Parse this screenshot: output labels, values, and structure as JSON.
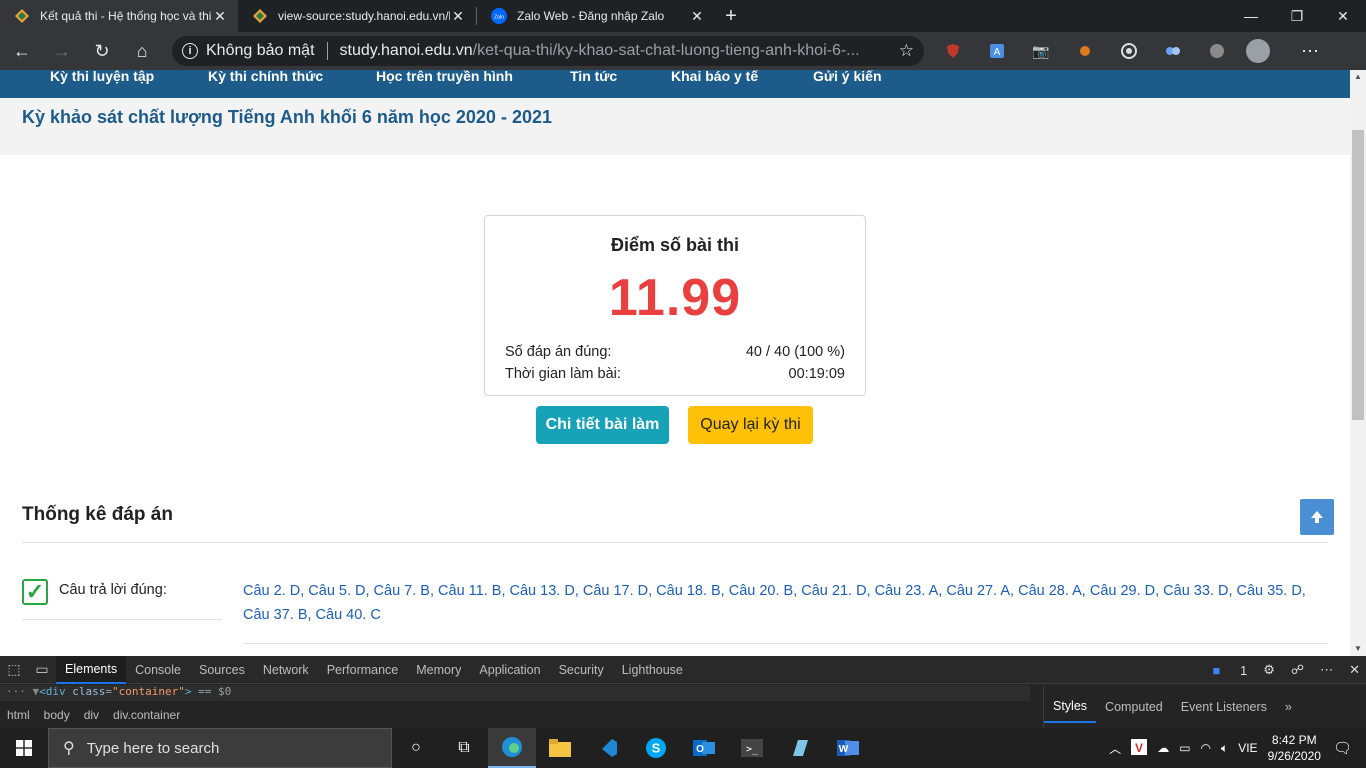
{
  "browser": {
    "tabs": [
      {
        "title": "Kết quả thi - Hệ thống học và thi",
        "active": true
      },
      {
        "title": "view-source:study.hanoi.edu.vn/k",
        "active": false
      },
      {
        "title": "Zalo Web - Đăng nhập Zalo",
        "active": false
      }
    ],
    "security_label": "Không bảo mật",
    "url_host": "study.hanoi.edu.vn",
    "url_path": "/ket-qua-thi/ky-khao-sat-chat-luong-tieng-anh-khoi-6-..."
  },
  "site_nav": {
    "items": [
      "Kỳ thi luyện tập",
      "Kỳ thi chính thức",
      "Học trên truyền hình",
      "Tin tức",
      "Khai báo y tế",
      "Gửi ý kiến"
    ]
  },
  "page_title": "Kỳ khảo sát chất lượng Tiếng Anh khối 6 năm học 2020 - 2021",
  "score_card": {
    "heading": "Điểm số bài thi",
    "score": "11.99",
    "correct_label": "Số đáp án đúng:",
    "correct_value": "40 / 40 (100 %)",
    "time_label": "Thời gian làm bài:",
    "time_value": "00:19:09"
  },
  "buttons": {
    "detail": "Chi tiết bài làm",
    "back": "Quay lại kỳ thi"
  },
  "stats": {
    "heading": "Thống kê đáp án",
    "correct_answers_label": "Câu trả lời đúng:",
    "correct_answers": "Câu 2. D, Câu 5. D, Câu 7. B, Câu 11. B, Câu 13. D, Câu 17. D, Câu 18. B, Câu 20. B, Câu 21. D, Câu 23. A, Câu 27. A, Câu 28. A, Câu 29. D, Câu 33. D, Câu 35. D, Câu 37. B, Câu 40. C"
  },
  "devtools": {
    "tabs": [
      "Elements",
      "Console",
      "Sources",
      "Network",
      "Performance",
      "Memory",
      "Application",
      "Security",
      "Lighthouse"
    ],
    "issues_count": "1",
    "code_line": {
      "tag_open": "<div",
      "attr": "class",
      "value": "\"container\"",
      "tag_close": ">",
      "suffix": "== $0"
    },
    "breadcrumb": [
      "html",
      "body",
      "div",
      "div.container"
    ],
    "side_tabs": [
      "Styles",
      "Computed",
      "Event Listeners"
    ]
  },
  "taskbar": {
    "search_placeholder": "Type here to search",
    "lang": "VIE",
    "time": "8:42 PM",
    "date": "9/26/2020"
  },
  "colors": {
    "nav_blue": "#1d5b8a",
    "score_red": "#e9403f",
    "detail_btn": "#17a2b8",
    "back_btn": "#ffc107",
    "answer_blue": "#1d5fb8"
  }
}
